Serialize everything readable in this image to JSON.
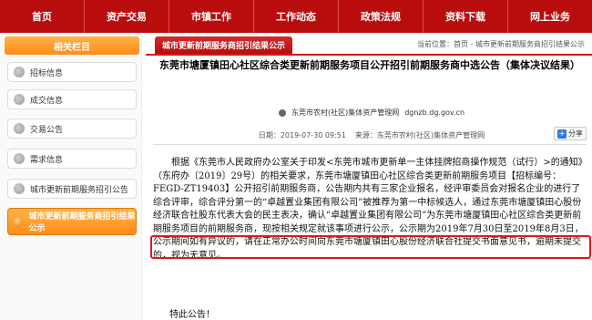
{
  "nav": [
    "首页",
    "资产交易",
    "市镇工作",
    "工作动态",
    "政策法规",
    "资料下载",
    "网上业务"
  ],
  "sidebar": {
    "header": "相关栏目",
    "items": [
      "招标信息",
      "成交信息",
      "交易公告",
      "需求信息",
      "城市更新前期服务招引公告",
      "城市更新前期服务商招引结果公示"
    ],
    "active_index": 5
  },
  "content": {
    "tab_title": "城市更新前期服务商招引结果公示",
    "breadcrumb": "当前位置：首页 - 城市更新前期服务商招引结果公示",
    "title": "东莞市塘厦镇田心社区综合类更新前期服务项目公开招引前期服务商中选公告（集体决议结果）",
    "source_left": "东莞市农村(社区)集体资产管理网",
    "source_right": "dgnzb.dg.gov.cn",
    "meta_date": "日期：2019-07-30 09:51",
    "meta_source": "来源：东莞市农村(社区)集体资产管理网",
    "share": "分享",
    "body_paragraph": "根据《东莞市人民政府办公室关于印发<东莞市城市更新单一主体挂牌招商操作规范（试行）>的通知》（东府办〔2019〕29号）的相关要求，东莞市塘厦镇田心社区综合类更新前期服务项目【招标编号：FEGD-ZT19403】公开招引前期服务商，公告期内共有三家企业报名，经评审委员会对报名企业的进行了综合评审，综合评分第一的“卓越置业集团有限公司”被推荐为第一中标候选人，通过东莞市塘厦镇田心股份经济联合社股东代表大会的民主表决，确认“卓越置业集团有限公司”为东莞市塘厦镇田心社区综合类更新前期服务项目的前期服务商，现按相关规定就该事项进行公示，公示期为2019年7月30日至2019年8月3日，公示期间如有异议的，请在正常办公时间向东莞市塘厦镇田心股份经济联合社提交书面意见书，逾期未提交的，视为无意见。",
    "closing": "特此公告！"
  },
  "colors": {
    "nav_red": "#b90d0d",
    "accent_orange": "#ff8c1a",
    "highlight_red": "#d81b1b"
  }
}
